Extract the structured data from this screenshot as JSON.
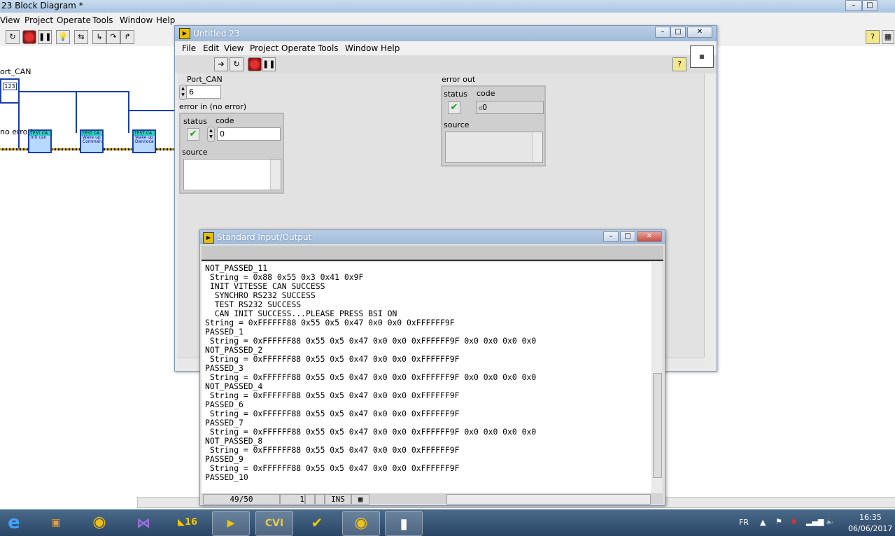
{
  "block_diagram": {
    "title": "23 Block Diagram *",
    "menu": [
      "View",
      "Project",
      "Operate",
      "Tools",
      "Window",
      "Help"
    ],
    "labels": {
      "port_can": "ort_CAN",
      "error_in": "no error)",
      "num_const": "123"
    },
    "subvis": [
      {
        "head": "TEST CA",
        "body": "Init can"
      },
      {
        "head": "TEST CA",
        "body": "Wake up Comman"
      },
      {
        "head": "TEST CA",
        "body": "Wake up Dannoca"
      }
    ]
  },
  "front_panel": {
    "title": "Untitled 23",
    "menu": [
      "File",
      "Edit",
      "View",
      "Project",
      "Operate",
      "Tools",
      "Window",
      "Help"
    ],
    "port_can": {
      "label": "Port_CAN",
      "value": "6"
    },
    "error_in": {
      "label": "error in (no error)",
      "status_label": "status",
      "code_label": "code",
      "code_value": "0",
      "source_label": "source"
    },
    "error_out": {
      "label": "error out",
      "status_label": "status",
      "code_label": "code",
      "code_value": "0",
      "code_prefix": "d",
      "source_label": "source"
    }
  },
  "stdio": {
    "title": "Standard Input/Output",
    "lines": [
      "NOT_PASSED_11",
      " String = 0x88 0x55 0x3 0x41 0x9F",
      " INIT VITESSE CAN SUCCESS",
      "  SYNCHRO RS232 SUCCESS",
      "  TEST RS232 SUCCESS",
      "  CAN INIT SUCCESS...PLEASE PRESS BSI ON",
      "String = 0xFFFFFF88 0x55 0x5 0x47 0x0 0x0 0xFFFFFF9F",
      "PASSED_1",
      " String = 0xFFFFFF88 0x55 0x5 0x47 0x0 0x0 0xFFFFFF9F 0x0 0x0 0x0 0x0",
      "NOT_PASSED_2",
      " String = 0xFFFFFF88 0x55 0x5 0x47 0x0 0x0 0xFFFFFF9F",
      "PASSED_3",
      " String = 0xFFFFFF88 0x55 0x5 0x47 0x0 0x0 0xFFFFFF9F 0x0 0x0 0x0 0x0",
      "NOT_PASSED_4",
      " String = 0xFFFFFF88 0x55 0x5 0x47 0x0 0x0 0xFFFFFF9F",
      "PASSED_6",
      " String = 0xFFFFFF88 0x55 0x5 0x47 0x0 0x0 0xFFFFFF9F",
      "PASSED_7",
      " String = 0xFFFFFF88 0x55 0x5 0x47 0x0 0x0 0xFFFFFF9F 0x0 0x0 0x0 0x0",
      "NOT_PASSED_8",
      " String = 0xFFFFFF88 0x55 0x5 0x47 0x0 0x0 0xFFFFFF9F",
      "PASSED_9",
      " String = 0xFFFFFF88 0x55 0x5 0x47 0x0 0x0 0xFFFFFF9F",
      "PASSED_10"
    ],
    "status": {
      "line": "49/50",
      "col": "1",
      "mode": "INS"
    }
  },
  "taskbar": {
    "apps": [
      "ie-icon",
      "media-icon",
      "chrome-icon",
      "visual-studio-icon",
      "labview-2016-icon",
      "labview-vi-icon",
      "CVI",
      "teststand-icon",
      "chrome-icon",
      "editor-icon"
    ],
    "cvi_label": "CVI",
    "lang": "FR",
    "time": "16:35",
    "date": "06/06/2017"
  },
  "colors": {
    "wire": "#1a3ea8",
    "check": "#16a316",
    "title_active": "#a2bbd9",
    "taskbar": "#2a4566"
  }
}
